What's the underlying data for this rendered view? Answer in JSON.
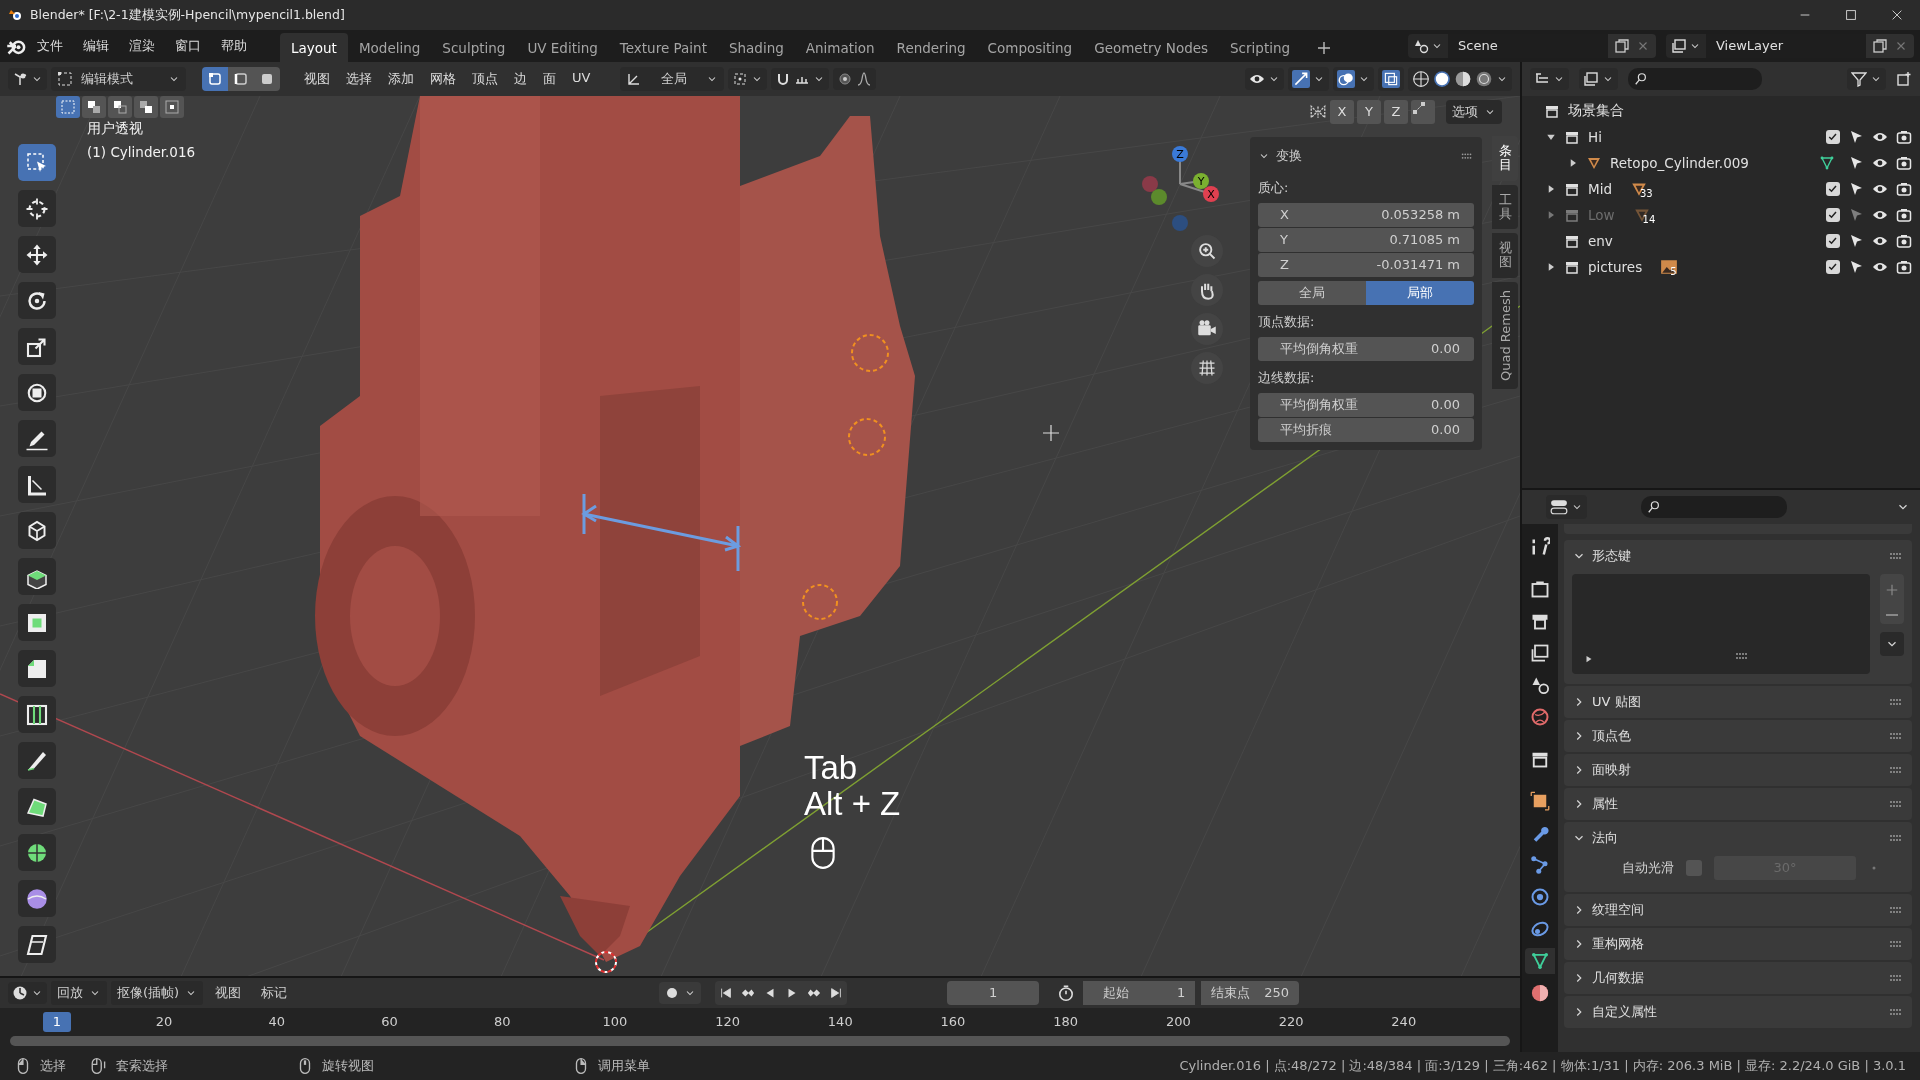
{
  "window": {
    "title": "Blender* [F:\\2-1建模实例-Hpencil\\mypencil1.blend]"
  },
  "menu": [
    "文件",
    "编辑",
    "渲染",
    "窗口",
    "帮助"
  ],
  "workspaces": [
    {
      "label": "Layout",
      "selected": true
    },
    {
      "label": "Modeling",
      "selected": false
    },
    {
      "label": "Sculpting",
      "selected": false
    },
    {
      "label": "UV Editing",
      "selected": false
    },
    {
      "label": "Texture Paint",
      "selected": false
    },
    {
      "label": "Shading",
      "selected": false
    },
    {
      "label": "Animation",
      "selected": false
    },
    {
      "label": "Rendering",
      "selected": false
    },
    {
      "label": "Compositing",
      "selected": false
    },
    {
      "label": "Geometry Nodes",
      "selected": false
    },
    {
      "label": "Scripting",
      "selected": false
    }
  ],
  "scene": "Scene",
  "view_layer": "ViewLayer",
  "viewport_header": {
    "mode": "编辑模式",
    "select_modes": [
      {
        "kind": "vertex",
        "selected": true
      },
      {
        "kind": "edge",
        "selected": false
      },
      {
        "kind": "face",
        "selected": false
      }
    ],
    "menus": [
      "视图",
      "选择",
      "添加",
      "网格",
      "顶点",
      "边",
      "面",
      "UV"
    ],
    "orientation": "全局"
  },
  "tools": [
    {
      "kind": "select",
      "selected": true
    },
    {
      "kind": "cursor",
      "selected": false
    },
    {
      "kind": "move",
      "selected": false
    },
    {
      "kind": "rotate",
      "selected": false
    },
    {
      "kind": "scale",
      "selected": false
    },
    {
      "kind": "transform",
      "selected": false
    },
    {
      "kind": "annotate",
      "selected": false
    },
    {
      "kind": "measure",
      "selected": false
    },
    {
      "kind": "add_cube",
      "selected": false
    },
    {
      "kind": "extrude",
      "selected": false
    },
    {
      "kind": "inset",
      "selected": false
    },
    {
      "kind": "bevel",
      "selected": false
    },
    {
      "kind": "loop_cut",
      "selected": false
    },
    {
      "kind": "knife",
      "selected": false
    },
    {
      "kind": "poly_build",
      "selected": false
    },
    {
      "kind": "spin",
      "selected": false
    },
    {
      "kind": "smooth",
      "selected": false
    },
    {
      "kind": "shear",
      "selected": false
    }
  ],
  "viewport": {
    "view_name": "用户透视",
    "object": "(1) Cylinder.016",
    "mirror_axes": [
      "X",
      "Y",
      "Z"
    ],
    "options": "选项",
    "gizmo_axes": [
      "Z",
      "Y",
      "X"
    ],
    "key_hint": [
      "Tab",
      "Alt + Z"
    ]
  },
  "sidebar_tabs": [
    {
      "label": "条目",
      "kind": "cjk",
      "selected": true
    },
    {
      "label": "工具",
      "kind": "cjk",
      "selected": false
    },
    {
      "label": "视图",
      "kind": "cjk",
      "selected": false
    },
    {
      "label": "Quad Remesh",
      "kind": "latin",
      "selected": false
    }
  ],
  "transform_panel": {
    "title": "变换",
    "median_label": "质心:",
    "coords": [
      {
        "axis": "X",
        "value": "0.053258 m"
      },
      {
        "axis": "Y",
        "value": "0.71085 m"
      },
      {
        "axis": "Z",
        "value": "-0.031471 m"
      }
    ],
    "space": [
      {
        "label": "全局",
        "selected": false
      },
      {
        "label": "局部",
        "selected": true
      }
    ],
    "vertex_label": "顶点数据:",
    "vertex_fields": [
      {
        "label": "平均倒角权重",
        "value": "0.00"
      }
    ],
    "edge_label": "边线数据:",
    "edge_fields": [
      {
        "label": "平均倒角权重",
        "value": "0.00"
      },
      {
        "label": "平均折痕",
        "value": "0.00"
      }
    ]
  },
  "outliner": {
    "root": "场景集合",
    "items": [
      {
        "name": "Hi",
        "kind": "collection",
        "expanded": true,
        "checked": true,
        "disabled": false,
        "children": [
          {
            "name": "Retopo_Cylinder.009",
            "kind": "object",
            "expanded": false,
            "disabled": false
          }
        ]
      },
      {
        "name": "Mid",
        "kind": "collection",
        "expanded": false,
        "checked": true,
        "disabled": false,
        "badge": {
          "count": "33",
          "kind": "mesh"
        }
      },
      {
        "name": "Low",
        "kind": "collection",
        "expanded": false,
        "checked": true,
        "disabled": true,
        "badge": {
          "count": "14",
          "kind": "mesh"
        }
      },
      {
        "name": "env",
        "kind": "collection",
        "checked": true,
        "disabled": false
      },
      {
        "name": "pictures",
        "kind": "collection",
        "expanded": false,
        "checked": true,
        "disabled": false,
        "badge": {
          "count": "5",
          "kind": "image"
        }
      }
    ]
  },
  "properties_tabs": [
    {
      "kind": "tool",
      "selected": false
    },
    {
      "kind": "render",
      "selected": false
    },
    {
      "kind": "output",
      "selected": false
    },
    {
      "kind": "view_layer",
      "selected": false
    },
    {
      "kind": "scene",
      "selected": false
    },
    {
      "kind": "world",
      "selected": false
    },
    {
      "kind": "collection",
      "selected": false
    },
    {
      "kind": "object",
      "selected": false
    },
    {
      "kind": "modifier",
      "selected": false
    },
    {
      "kind": "particles",
      "selected": false
    },
    {
      "kind": "physics",
      "selected": false
    },
    {
      "kind": "constraints",
      "selected": false
    },
    {
      "kind": "data",
      "selected": true
    },
    {
      "kind": "material",
      "selected": false
    }
  ],
  "properties_panels": [
    {
      "title": "形态键",
      "kind": "shape_keys",
      "expanded": true
    },
    {
      "title": "UV 贴图",
      "kind": "plain",
      "expanded": false
    },
    {
      "title": "顶点色",
      "kind": "plain",
      "expanded": false
    },
    {
      "title": "面映射",
      "kind": "plain",
      "expanded": false
    },
    {
      "title": "属性",
      "kind": "plain",
      "expanded": false
    },
    {
      "title": "法向",
      "kind": "normals",
      "expanded": true,
      "auto_smooth": {
        "label": "自动光滑",
        "checked": false,
        "angle": "30°"
      }
    },
    {
      "title": "纹理空间",
      "kind": "plain",
      "expanded": false
    },
    {
      "title": "重构网格",
      "kind": "plain",
      "expanded": false
    },
    {
      "title": "几何数据",
      "kind": "plain",
      "expanded": false
    },
    {
      "title": "自定义属性",
      "kind": "plain",
      "expanded": false
    }
  ],
  "timeline": {
    "menus": [
      {
        "label": "回放",
        "kind": "dropdown"
      },
      {
        "label": "抠像(插帧)",
        "kind": "dropdown"
      },
      {
        "label": "视图",
        "kind": "menu"
      },
      {
        "label": "标记",
        "kind": "menu"
      }
    ],
    "current_frame": "1",
    "start_label": "起始",
    "start": "1",
    "end_label": "结束点",
    "end": "250",
    "ruler": [
      "20",
      "40",
      "60",
      "80",
      "100",
      "120",
      "140",
      "160",
      "180",
      "200",
      "220",
      "240"
    ],
    "ruler_current": "1"
  },
  "status_bar": {
    "hints": [
      "选择",
      "套索选择",
      "旋转视图",
      "调用菜单"
    ],
    "stats": "Cylinder.016 | 点:48/272 | 边:48/384 | 面:3/129 | 三角:462 | 物体:1/31 | 内存: 206.3 MiB | 显存: 2.2/24.0 GiB | 3.0.1"
  }
}
